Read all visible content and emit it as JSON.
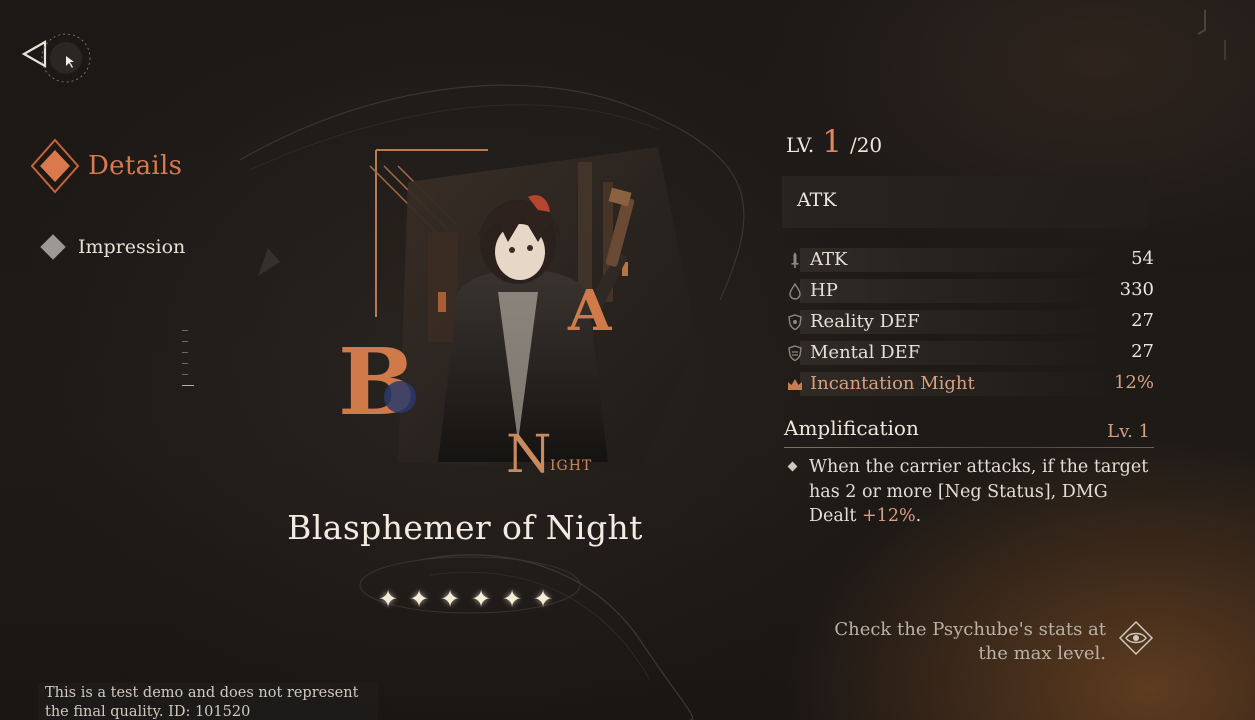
{
  "nav": {
    "back_icon": "back-triangle-icon",
    "items": [
      {
        "label": "Details",
        "active": true
      },
      {
        "label": "Impression",
        "active": false
      }
    ]
  },
  "item": {
    "name": "Blasphemer of Night",
    "art_letters": [
      "B",
      "A",
      "N",
      "IGHT"
    ],
    "stars": [
      "✦",
      "✦",
      "✦",
      "✦",
      "✦",
      "✦"
    ],
    "rarity": 6
  },
  "level": {
    "label": "LV.",
    "current": "1",
    "max": "/20"
  },
  "type_label": "ATK",
  "stats": [
    {
      "name": "ATK",
      "value": "54",
      "icon": "sword-icon"
    },
    {
      "name": "HP",
      "value": "330",
      "icon": "drop-icon"
    },
    {
      "name": "Reality DEF",
      "value": "27",
      "icon": "shield-icon"
    },
    {
      "name": "Mental DEF",
      "value": "27",
      "icon": "shield-icon"
    },
    {
      "name": "Incantation Might",
      "value": "12%",
      "icon": "crown-icon"
    }
  ],
  "amplification": {
    "title": "Amplification",
    "level": "Lv. 1",
    "desc_main": "When the carrier attacks, if the target has 2 or more [Neg Status], DMG Dealt ",
    "desc_highlight": "+12%",
    "desc_end": "."
  },
  "check_text": "Check the Psychube's stats at the max level.",
  "disclaimer": "This is a test demo and does not represent the final quality. ID: 101520",
  "colors": {
    "accent": "#d9794d",
    "highlight": "#d9a07e",
    "text": "#e9e2d6"
  }
}
